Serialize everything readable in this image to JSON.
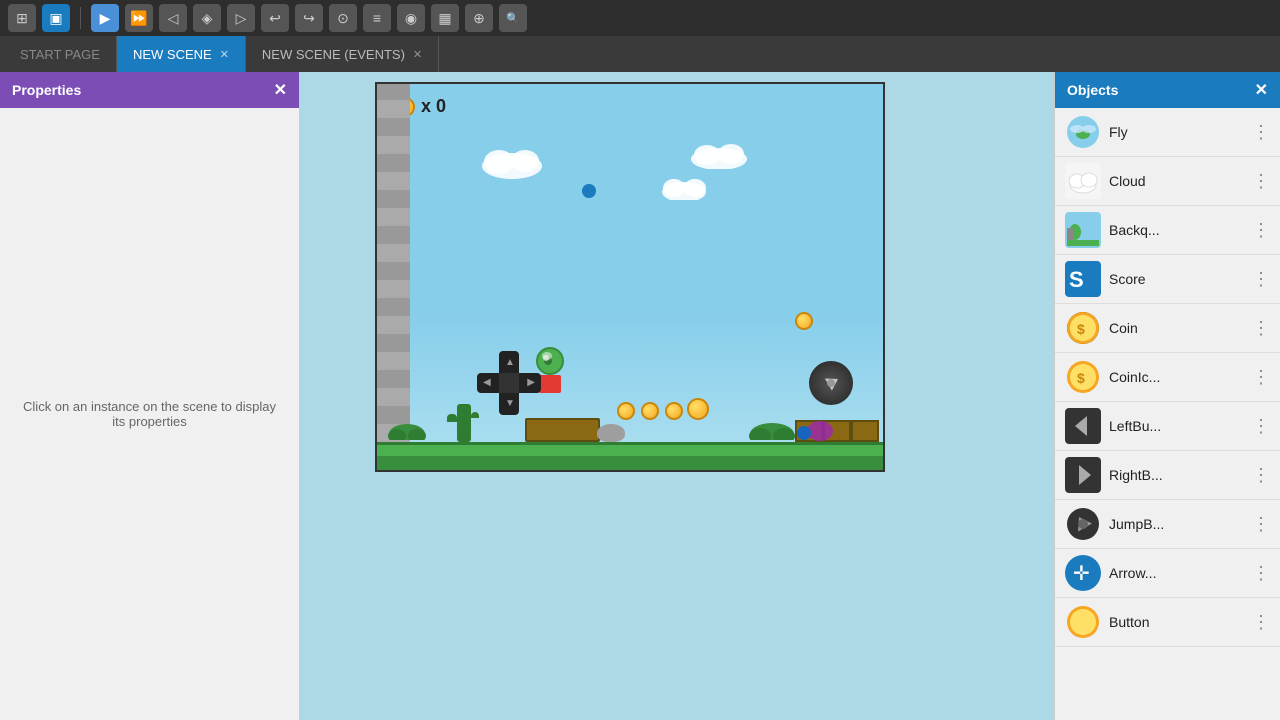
{
  "toolbar": {
    "buttons": [
      "⊞",
      "▣",
      "▶",
      "⏎",
      "←",
      "→",
      "⊙",
      "≡",
      "◉",
      "▦",
      "⊕",
      "↑"
    ]
  },
  "tabs": [
    {
      "label": "START PAGE",
      "active": false,
      "closable": false
    },
    {
      "label": "NEW SCENE",
      "active": true,
      "closable": true
    },
    {
      "label": "NEW SCENE (EVENTS)",
      "active": false,
      "closable": true
    }
  ],
  "properties_panel": {
    "title": "Properties",
    "placeholder_text": "Click on an instance on the scene to\ndisplay its properties"
  },
  "objects_panel": {
    "title": "Objects",
    "items": [
      {
        "label": "Fly",
        "icon_type": "fly"
      },
      {
        "label": "Cloud",
        "icon_type": "cloud"
      },
      {
        "label": "Backq...",
        "icon_type": "backq"
      },
      {
        "label": "Score",
        "icon_type": "score"
      },
      {
        "label": "Coin",
        "icon_type": "coin"
      },
      {
        "label": "CoinIc...",
        "icon_type": "coinic"
      },
      {
        "label": "LeftBu...",
        "icon_type": "leftbu"
      },
      {
        "label": "RightB...",
        "icon_type": "rightb"
      },
      {
        "label": "JumpB...",
        "icon_type": "jumpb"
      },
      {
        "label": "Arrow...",
        "icon_type": "arrow"
      },
      {
        "label": "Button",
        "icon_type": "button"
      }
    ]
  },
  "scene": {
    "score_display": "x 0"
  }
}
